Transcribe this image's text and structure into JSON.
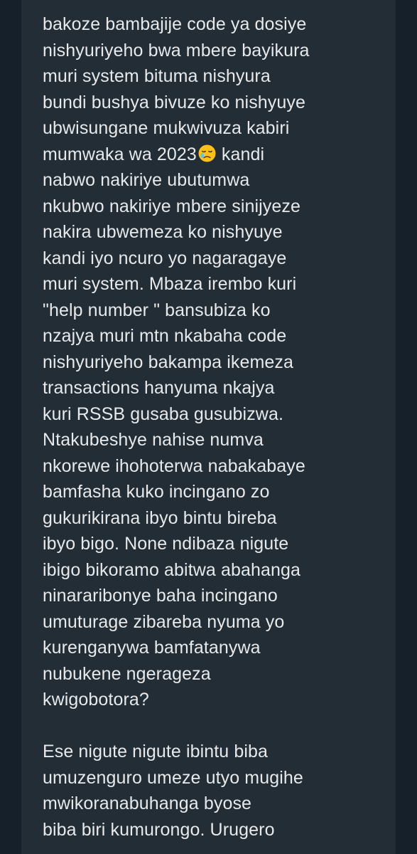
{
  "message": {
    "paragraph1": [
      "bakoze bambajije code ya dosiye",
      "nishyuriyeho bwa mbere bayikura",
      "muri system bituma nishyura",
      "bundi bushya bivuze ko nishyuye",
      "ubwisungane mukwivuza kabiri",
      "mumwaka wa 2023",
      " kandi",
      "nabwo nakiriye ubutumwa",
      "nkubwo nakiriye mbere sinijyeze",
      "nakira ubwemeza ko nishyuye",
      "kandi iyo ncuro yo nagaragaye",
      "muri system. Mbaza irembo kuri",
      "\"help number \" bansubiza ko",
      "nzajya muri mtn nkabaha code",
      "nishyuriyeho bakampa ikemeza",
      "transactions hanyuma nkajya",
      "kuri RSSB gusaba gusubizwa.",
      "Ntakubeshye nahise numva",
      "nkorewe ihohoterwa nabakabaye",
      "bamfasha kuko incingano zo",
      "gukurikirana ibyo bintu bireba",
      "ibyo bigo. None ndibaza nigute",
      "ibigo bikoramo abitwa abahanga",
      "ninararibonye baha incingano",
      "umuturage zibareba nyuma yo",
      "kurenganywa bamfatanywa",
      "nubukene ngerageza",
      "kwigobotora?"
    ],
    "paragraph2": [
      "Ese nigute nigute ibintu biba",
      "umuzenguro umeze utyo mugihe",
      "mwikoranabuhanga byose",
      "biba biri kumurongo. Urugero"
    ],
    "emoji": "sleepy-face-emoji"
  }
}
